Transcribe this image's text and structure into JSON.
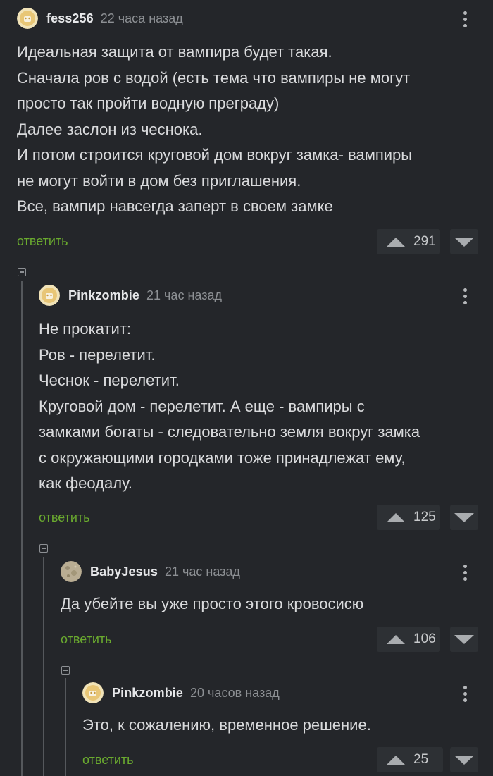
{
  "comments": [
    {
      "author": "fess256",
      "time": "22 часа назад",
      "lines": [
        "Идеальная защита от вампира будет такая.",
        "Сначала ров с водой (есть тема что вампиры не могут",
        "просто так пройти водную преграду)",
        "Далее заслон из чеснока.",
        "И потом строится круговой дом вокруг замка- вампиры",
        "не могут войти в дом без приглашения.",
        "Все, вампир навсегда заперт в своем замке"
      ],
      "reply_label": "ответить",
      "rating": "291",
      "avatar_icon": "user-avatar-icon"
    },
    {
      "author": "Pinkzombie",
      "time": "21 час назад",
      "lines": [
        "Не прокатит:",
        "Ров - перелетит.",
        "Чеснок - перелетит.",
        "Круговой дом - перелетит. А еще - вампиры с",
        "замками богаты - следовательно земля вокруг замка",
        "с окружающими городками тоже принадлежат ему,",
        "как феодалу."
      ],
      "reply_label": "ответить",
      "rating": "125",
      "avatar_icon": "user-avatar-icon"
    },
    {
      "author": "BabyJesus",
      "time": "21 час назад",
      "lines": [
        "Да убейте вы уже просто этого кровосисю"
      ],
      "reply_label": "ответить",
      "rating": "106",
      "avatar_icon": "moon-avatar-icon"
    },
    {
      "author": "Pinkzombie",
      "time": "20 часов назад",
      "lines": [
        "Это, к сожалению, временное решение."
      ],
      "reply_label": "ответить",
      "rating": "25",
      "avatar_icon": "user-avatar-icon"
    }
  ],
  "colors": {
    "background": "#24262a",
    "reply_link": "#6aaa2f",
    "vote_button_bg": "#2d3034",
    "muted_text": "#8d9094"
  }
}
